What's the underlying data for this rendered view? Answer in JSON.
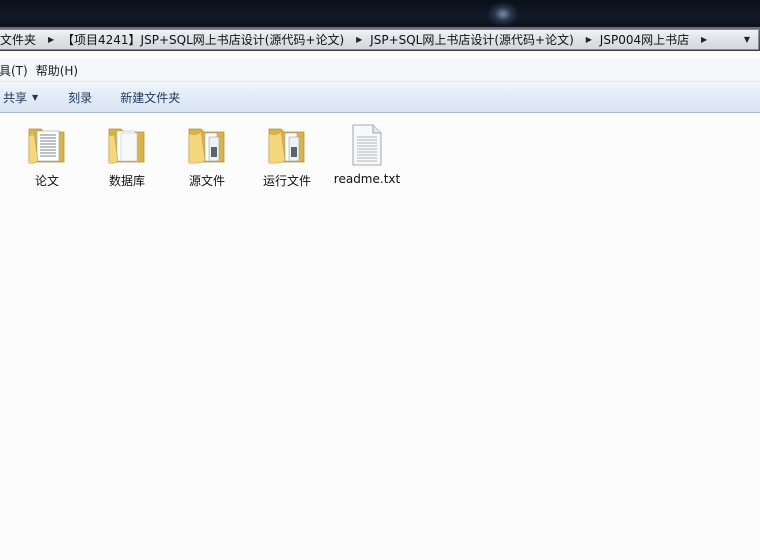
{
  "address_bar": {
    "crumbs": [
      "文件夹",
      "【项目4241】JSP+SQL网上书店设计(源代码+论文)",
      "JSP+SQL网上书店设计(源代码+论文)",
      "JSP004网上书店"
    ]
  },
  "menu": {
    "items": [
      "具(T)",
      "帮助(H)"
    ]
  },
  "toolbar": {
    "share": "共享",
    "burn": "刻录",
    "new_folder": "新建文件夹"
  },
  "files": [
    {
      "name": "论文",
      "type": "folder",
      "icon": "folder-documents-icon"
    },
    {
      "name": "数据库",
      "type": "folder",
      "icon": "folder-white-icon"
    },
    {
      "name": "源文件",
      "type": "folder",
      "icon": "folder-files-icon"
    },
    {
      "name": "运行文件",
      "type": "folder",
      "icon": "folder-files-icon"
    },
    {
      "name": "readme.txt",
      "type": "file",
      "icon": "text-file-icon"
    }
  ],
  "colors": {
    "toolbar_text": "#1e395b",
    "folder": "#e8c65c"
  }
}
